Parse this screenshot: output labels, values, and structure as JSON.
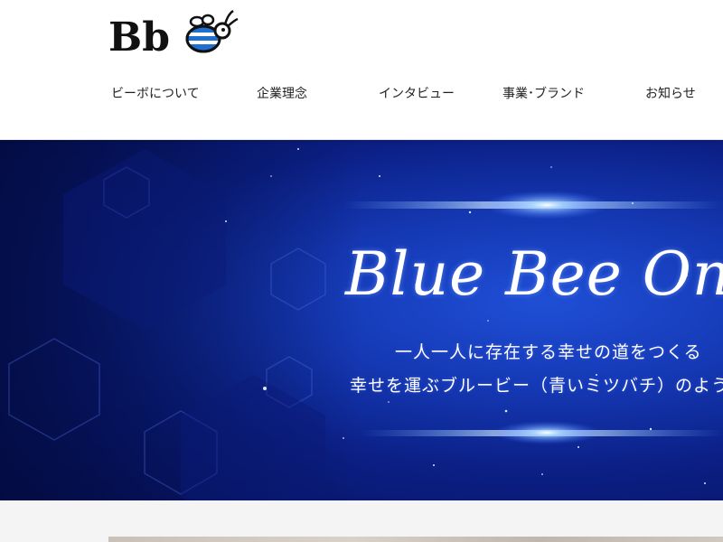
{
  "header": {
    "logo_text": "Bb",
    "nav": [
      {
        "label": "ビーボについて"
      },
      {
        "label": "企業理念"
      },
      {
        "label": "インタビュー"
      },
      {
        "label": "事業･ブランド"
      },
      {
        "label": "お知らせ"
      }
    ]
  },
  "hero": {
    "title": "Blue Bee One",
    "line1": "一人一人に存在する幸せの道をつくる",
    "line2": "幸せを運ぶブルービー（青いミツバチ）のように"
  },
  "colors": {
    "hero_blue": "#1539b5",
    "hero_dark": "#06105a",
    "logo_stripe": "#1f6fd1"
  }
}
